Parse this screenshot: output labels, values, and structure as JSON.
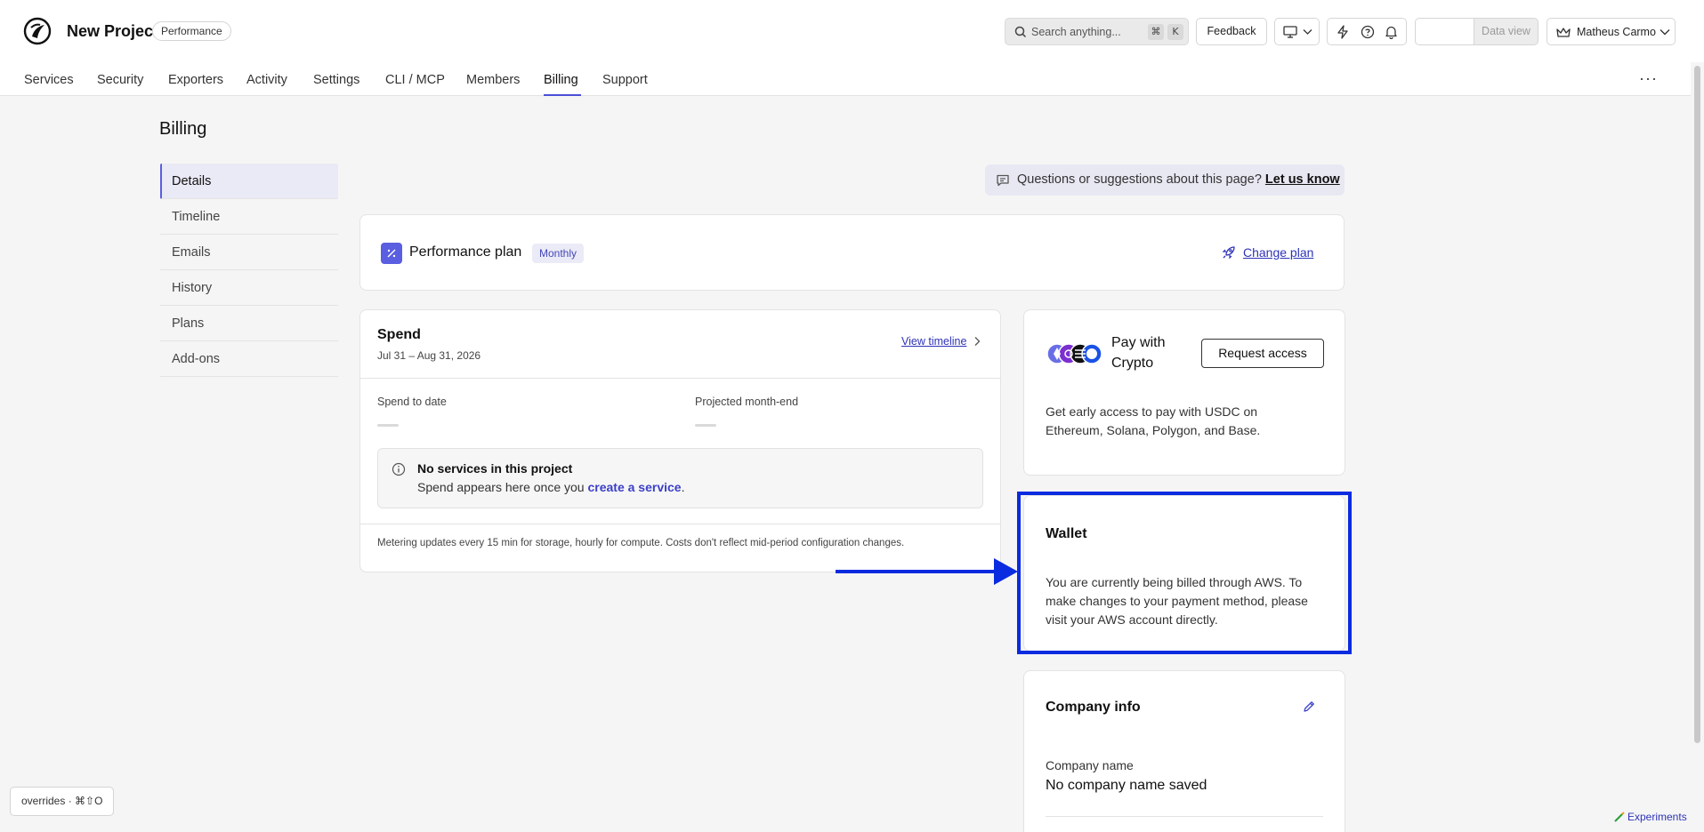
{
  "header": {
    "project_name": "New Project",
    "plan_badge": "Performance",
    "search_placeholder": "Search anything...",
    "search_kbd_cmd": "⌘",
    "search_kbd_key": "K",
    "feedback_label": "Feedback",
    "data_view_label": "Data view",
    "user_name": "Matheus Carmo"
  },
  "nav": {
    "items": [
      "Services",
      "Security",
      "Exporters",
      "Activity",
      "Settings",
      "CLI / MCP",
      "Members",
      "Billing",
      "Support"
    ],
    "active": "Billing",
    "more_label": "···"
  },
  "page": {
    "title": "Billing"
  },
  "sidebar": {
    "items": [
      "Details",
      "Timeline",
      "Emails",
      "History",
      "Plans",
      "Add-ons"
    ],
    "active": "Details"
  },
  "banner": {
    "text": "Questions or suggestions about this page?",
    "link": "Let us know"
  },
  "plan": {
    "title": "Performance plan",
    "cycle": "Monthly",
    "change_label": "Change plan"
  },
  "spend": {
    "title": "Spend",
    "date_range": "Jul 31 – Aug 31, 2026",
    "view_timeline": "View timeline",
    "to_date_label": "Spend to date",
    "projected_label": "Projected month-end",
    "notice_title": "No services in this project",
    "notice_text": "Spend appears here once you",
    "notice_link": "create a service",
    "notice_end": ".",
    "metering": "Metering updates every 15 min for storage, hourly for compute. Costs don't reflect mid-period configuration changes."
  },
  "crypto": {
    "title": "Pay with Crypto",
    "request_label": "Request access",
    "body": "Get early access to pay with USDC on Ethereum, Solana, Polygon, and Base."
  },
  "wallet": {
    "title": "Wallet",
    "body": "You are currently being billed through AWS. To make changes to your payment method, please visit your AWS account directly."
  },
  "company": {
    "title": "Company info",
    "name_label": "Company name",
    "name_value": "No company name saved"
  },
  "footer": {
    "overrides": "overrides · ⌘⇧O",
    "experiments": "Experiments"
  },
  "colors": {
    "accent": "#5a5ee0",
    "link": "#2f33b8",
    "annotation": "#0a2be0"
  }
}
